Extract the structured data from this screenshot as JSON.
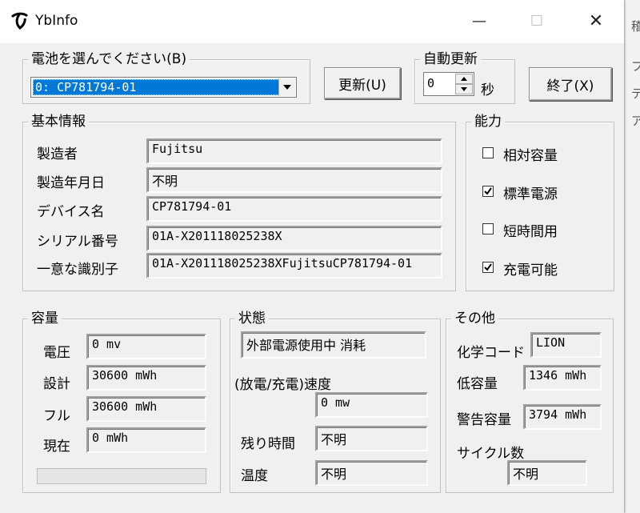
{
  "window": {
    "title": "YbInfo",
    "minimize": "—",
    "maximize": "☐",
    "close": "✕"
  },
  "background_window": {
    "chars": [
      "稽",
      "フ",
      "テ",
      "ア"
    ]
  },
  "battery_select": {
    "legend": "電池を選んでください(B)",
    "selected": "0: CP781794-01"
  },
  "refresh_button": "更新(U)",
  "auto_refresh": {
    "legend": "自動更新",
    "value": "0",
    "unit": "秒"
  },
  "exit_button": "終了(X)",
  "basic_info": {
    "legend": "基本情報",
    "rows": [
      {
        "label": "製造者",
        "value": "Fujitsu"
      },
      {
        "label": "製造年月日",
        "value": "不明"
      },
      {
        "label": "デバイス名",
        "value": "CP781794-01"
      },
      {
        "label": "シリアル番号",
        "value": "01A-X201118025238X"
      },
      {
        "label": "一意な識別子",
        "value": "01A-X201118025238XFujitsuCP781794-01"
      }
    ]
  },
  "capability": {
    "legend": "能力",
    "items": [
      {
        "label": "相対容量",
        "checked": false
      },
      {
        "label": "標準電源",
        "checked": true
      },
      {
        "label": "短時間用",
        "checked": false
      },
      {
        "label": "充電可能",
        "checked": true
      }
    ]
  },
  "capacity": {
    "legend": "容量",
    "rows": [
      {
        "label": "電圧",
        "value": "0 mv"
      },
      {
        "label": "設計",
        "value": "30600 mWh"
      },
      {
        "label": "フル",
        "value": "30600 mWh"
      },
      {
        "label": "現在",
        "value": "0 mWh"
      }
    ],
    "progress": 0
  },
  "status": {
    "legend": "状態",
    "state": "外部電源使用中 消耗",
    "rate_label": "(放電/充電)速度",
    "rate_value": "0 mw",
    "remaining_label": "残り時間",
    "remaining_value": "不明",
    "temperature_label": "温度",
    "temperature_value": "不明"
  },
  "other": {
    "legend": "その他",
    "chemistry_label": "化学コード",
    "chemistry_value": "LION",
    "low_label": "低容量",
    "low_value": "1346 mWh",
    "warning_label": "警告容量",
    "warning_value": "3794 mWh",
    "cycle_label": "サイクル数",
    "cycle_value": "不明"
  }
}
